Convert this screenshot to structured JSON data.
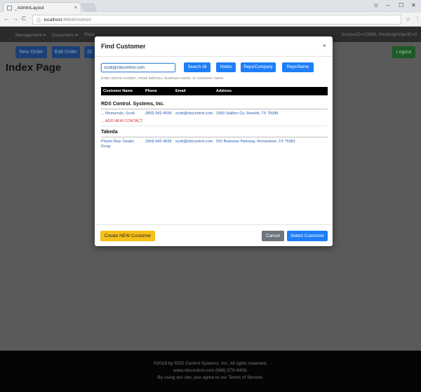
{
  "browser": {
    "tab_title": "_AdminLayout",
    "tab_close": "×",
    "address": {
      "host": "localhost",
      "port_path": ":49640/Admin/"
    },
    "window_controls": {
      "minimize": "–",
      "restore": "☐",
      "close": "✕"
    }
  },
  "app": {
    "nav": {
      "items": [
        {
          "label": "Management ▾"
        },
        {
          "label": "Customers ▾"
        },
        {
          "label": "Reps"
        }
      ],
      "status_text": "InvoiceID=10966, PendingOrderID=0"
    },
    "toolbar": {
      "new_order": "New Order",
      "edit_order": "Edit Order",
      "third": "Di",
      "logout": "Logout"
    },
    "page_title": "Index Page",
    "footer": {
      "line1": "©2018 by RDS Control Systems, Inc. All rights reserved.",
      "line2": "www.rdscontrol.com  (888) 578-9428.",
      "line3": "By using our site, you agree to our Terms of Service."
    }
  },
  "modal": {
    "title": "Find Customer",
    "close": "×",
    "search": {
      "value": "scott@rdscontrol.com",
      "hint": "Enter phone number, email address, business name, or customer name"
    },
    "buttons": {
      "search_all": "Search All",
      "hotels": "Hotels",
      "reps_company": "Reps/Company",
      "reps_name": "Reps/Name"
    },
    "columns": [
      "Customer Name",
      "Phone",
      "Email",
      "Address"
    ],
    "groups": [
      {
        "company": "RDS Control. Systems, Inc.",
        "rows": [
          {
            "name": "... Mcmurrain, Scott",
            "phone": "(850) 942-4559",
            "email": "scott@rdscontrol.com",
            "address": "1909 Stallion Cir, Rowlett, TX 75088"
          }
        ],
        "add_contact": "... ADD NEW CONTACT"
      },
      {
        "company": "Takeda",
        "rows": [
          {
            "name_line1": "Pharm Rep: Dealer,",
            "name_line2": "Doug",
            "phone": "(904) 942-4559",
            "email": "scott@rdscontrol.com",
            "address": "502 Business Parkway, Richardson, TX 75081"
          }
        ]
      }
    ],
    "footer": {
      "create": "Create NEW Customer",
      "cancel": "Cancel",
      "select": "Select Customer"
    }
  },
  "colors": {
    "primary": "#1e7ef7",
    "warning": "#f5c01a",
    "secondary": "#6c757d",
    "add_contact": "#d03030"
  }
}
